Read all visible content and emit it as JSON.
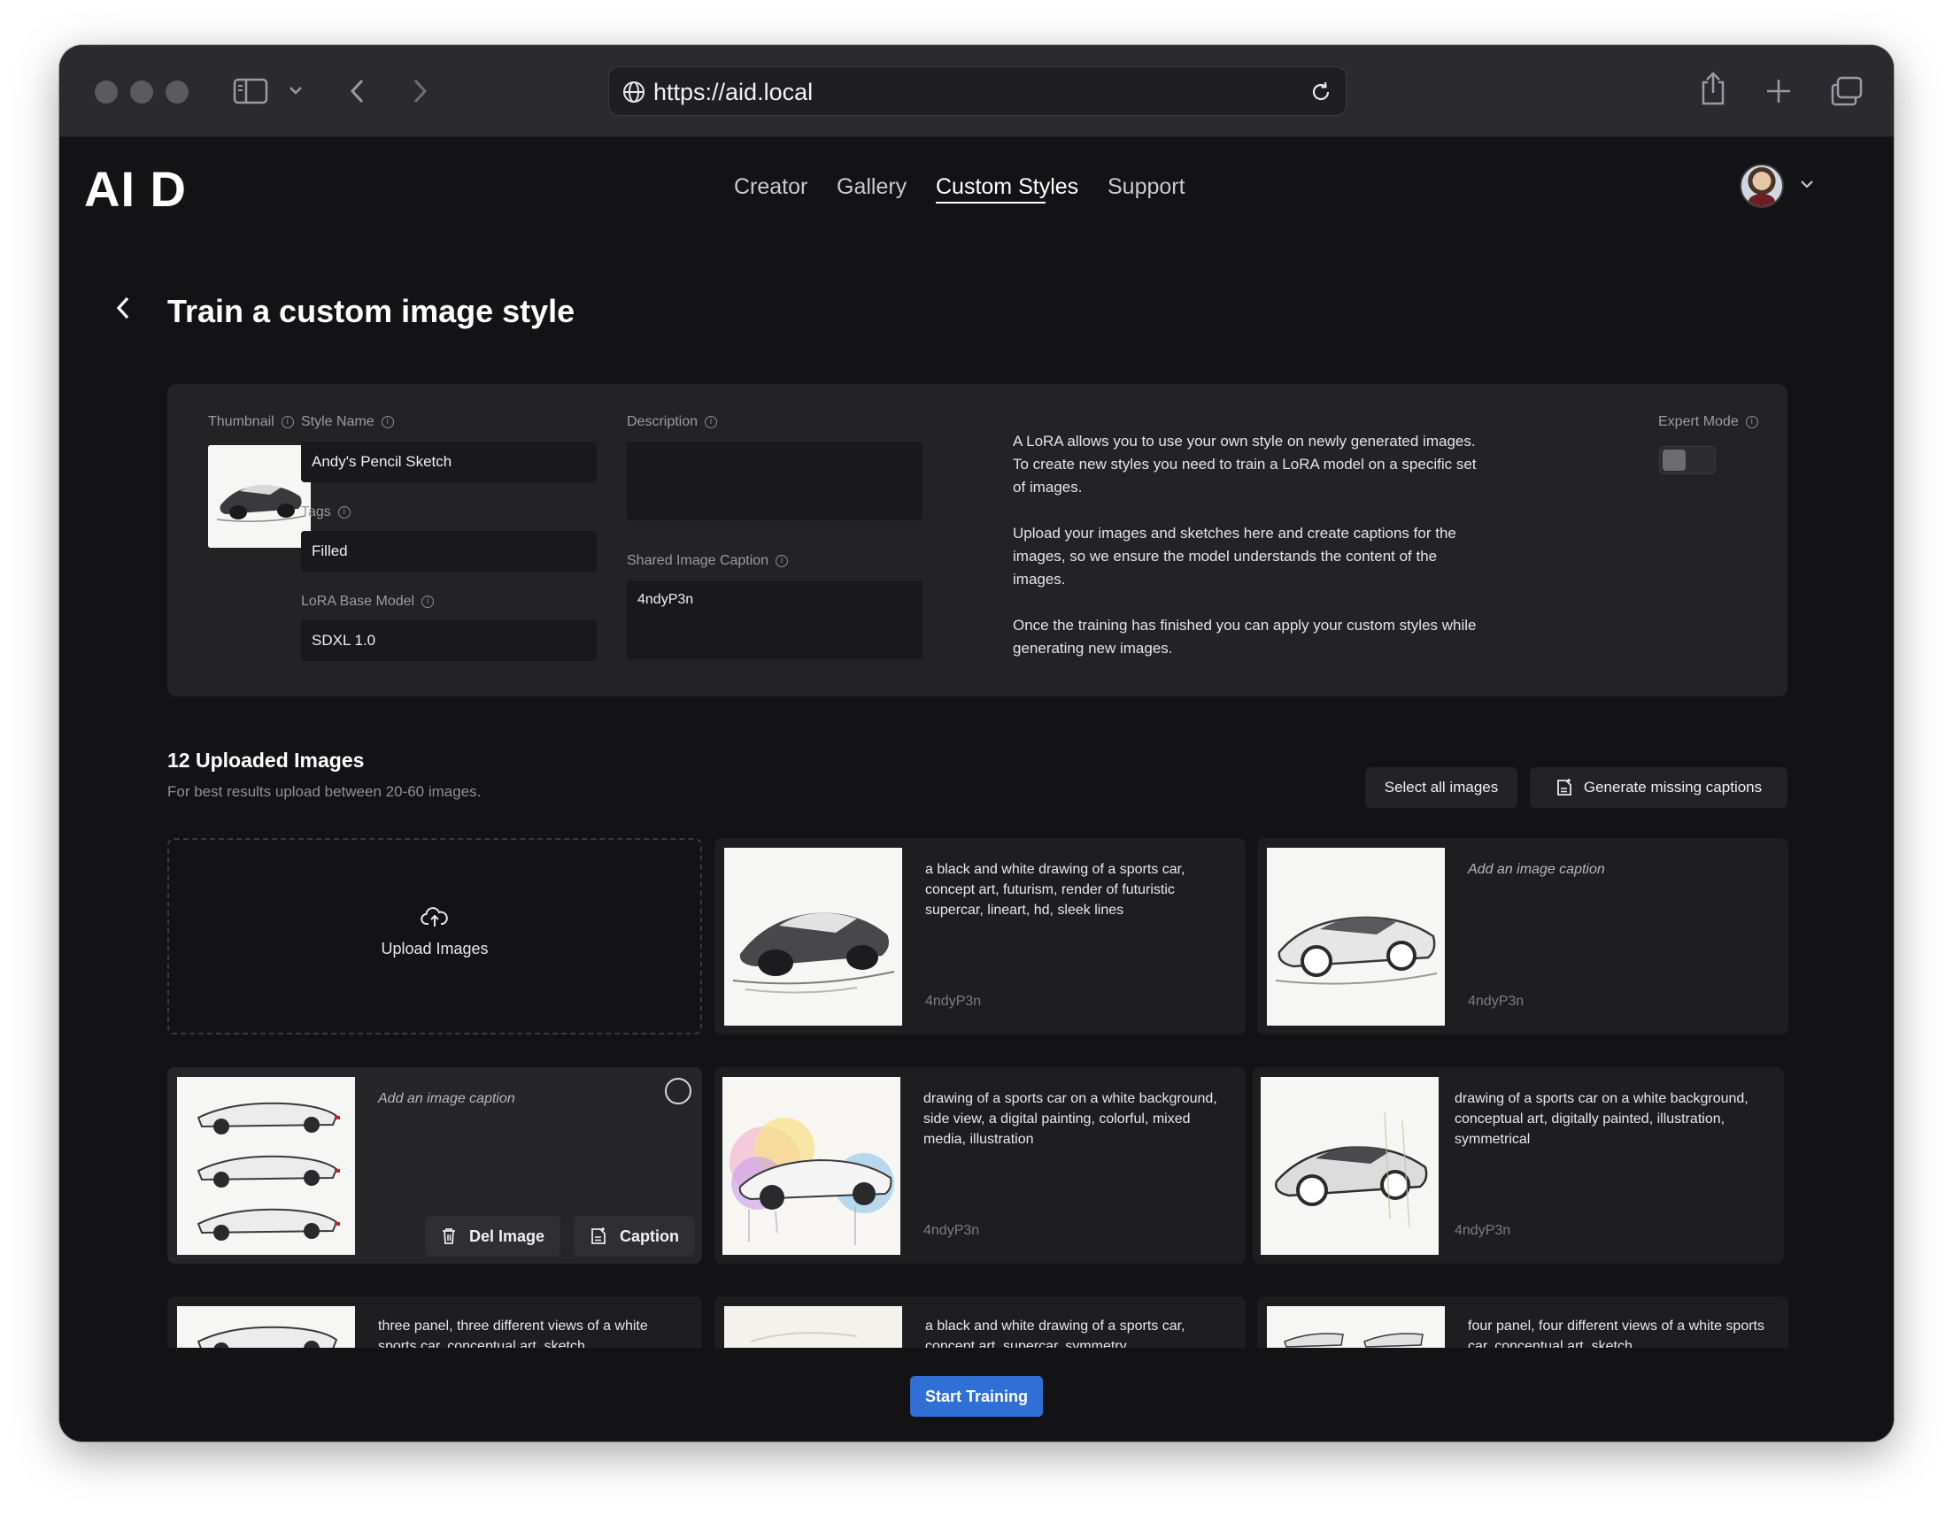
{
  "browser": {
    "url": "https://aid.local"
  },
  "app": {
    "logo": "AI D",
    "nav": [
      "Creator",
      "Gallery",
      "Custom Styles",
      "Support"
    ],
    "active_nav": "Custom Styles"
  },
  "page": {
    "title": "Train a custom image style"
  },
  "form": {
    "thumbnail_label": "Thumbnail",
    "style_name_label": "Style Name",
    "style_name_value": "Andy's Pencil Sketch",
    "tags_label": "Tags",
    "tags_value": "Filled",
    "base_model_label": "LoRA Base Model",
    "base_model_value": "SDXL 1.0",
    "description_label": "Description",
    "description_value": "",
    "shared_caption_label": "Shared Image Caption",
    "shared_caption_value": "4ndyP3n",
    "expert_mode_label": "Expert Mode",
    "expert_mode_on": false
  },
  "help": [
    "A LoRA allows you to use your own style on newly generated images. To create new styles you need to train a LoRA model on a specific set of images.",
    "Upload your images and sketches here and create captions for the images, so we ensure the model understands the content of the images.",
    "Once the training has finished you can apply your custom styles while generating new images."
  ],
  "uploads": {
    "title": "12 Uploaded Images",
    "subtitle": "For best results upload between 20-60 images.",
    "select_all": "Select all images",
    "generate_captions": "Generate missing captions",
    "upload_label": "Upload Images",
    "del_image": "Del Image",
    "caption_btn": "Caption",
    "placeholder": "Add an image caption",
    "shared": "4ndyP3n",
    "cards": [
      {
        "caption": "a black and white drawing of a sports car, concept art, futurism, render of futuristic supercar, lineart, hd, sleek lines"
      },
      {
        "caption": ""
      },
      {
        "caption": ""
      },
      {
        "caption": "drawing of a sports car on a white background, side view, a digital painting, colorful, mixed media, illustration"
      },
      {
        "caption": "drawing of a sports car on a white background, conceptual art, digitally painted, illustration, symmetrical"
      },
      {
        "caption": "three panel, three different views of a white sports car, conceptual art, sketch"
      },
      {
        "caption": "a black and white drawing of a sports car, concept art, supercar, symmetry"
      },
      {
        "caption": "four panel, four different views of a white sports car, conceptual art, sketch"
      }
    ]
  },
  "start_training": "Start Training"
}
